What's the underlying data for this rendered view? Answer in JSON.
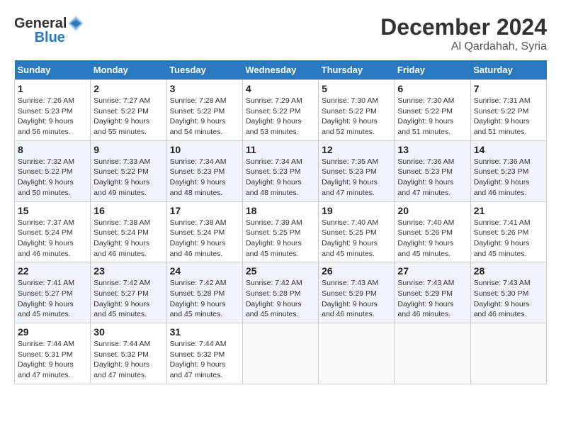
{
  "header": {
    "logo": {
      "text_general": "General",
      "text_blue": "Blue",
      "icon": "▶"
    },
    "title": "December 2024",
    "subtitle": "Al Qardahah, Syria"
  },
  "calendar": {
    "days_of_week": [
      "Sunday",
      "Monday",
      "Tuesday",
      "Wednesday",
      "Thursday",
      "Friday",
      "Saturday"
    ],
    "weeks": [
      [
        null,
        null,
        null,
        null,
        null,
        null,
        null
      ]
    ],
    "cells": [
      {
        "date": 1,
        "dow": 0,
        "sunrise": "7:26 AM",
        "sunset": "5:23 PM",
        "daylight": "9 hours and 56 minutes."
      },
      {
        "date": 2,
        "dow": 1,
        "sunrise": "7:27 AM",
        "sunset": "5:22 PM",
        "daylight": "9 hours and 55 minutes."
      },
      {
        "date": 3,
        "dow": 2,
        "sunrise": "7:28 AM",
        "sunset": "5:22 PM",
        "daylight": "9 hours and 54 minutes."
      },
      {
        "date": 4,
        "dow": 3,
        "sunrise": "7:29 AM",
        "sunset": "5:22 PM",
        "daylight": "9 hours and 53 minutes."
      },
      {
        "date": 5,
        "dow": 4,
        "sunrise": "7:30 AM",
        "sunset": "5:22 PM",
        "daylight": "9 hours and 52 minutes."
      },
      {
        "date": 6,
        "dow": 5,
        "sunrise": "7:30 AM",
        "sunset": "5:22 PM",
        "daylight": "9 hours and 51 minutes."
      },
      {
        "date": 7,
        "dow": 6,
        "sunrise": "7:31 AM",
        "sunset": "5:22 PM",
        "daylight": "9 hours and 51 minutes."
      },
      {
        "date": 8,
        "dow": 0,
        "sunrise": "7:32 AM",
        "sunset": "5:22 PM",
        "daylight": "9 hours and 50 minutes."
      },
      {
        "date": 9,
        "dow": 1,
        "sunrise": "7:33 AM",
        "sunset": "5:22 PM",
        "daylight": "9 hours and 49 minutes."
      },
      {
        "date": 10,
        "dow": 2,
        "sunrise": "7:34 AM",
        "sunset": "5:23 PM",
        "daylight": "9 hours and 48 minutes."
      },
      {
        "date": 11,
        "dow": 3,
        "sunrise": "7:34 AM",
        "sunset": "5:23 PM",
        "daylight": "9 hours and 48 minutes."
      },
      {
        "date": 12,
        "dow": 4,
        "sunrise": "7:35 AM",
        "sunset": "5:23 PM",
        "daylight": "9 hours and 47 minutes."
      },
      {
        "date": 13,
        "dow": 5,
        "sunrise": "7:36 AM",
        "sunset": "5:23 PM",
        "daylight": "9 hours and 47 minutes."
      },
      {
        "date": 14,
        "dow": 6,
        "sunrise": "7:36 AM",
        "sunset": "5:23 PM",
        "daylight": "9 hours and 46 minutes."
      },
      {
        "date": 15,
        "dow": 0,
        "sunrise": "7:37 AM",
        "sunset": "5:24 PM",
        "daylight": "9 hours and 46 minutes."
      },
      {
        "date": 16,
        "dow": 1,
        "sunrise": "7:38 AM",
        "sunset": "5:24 PM",
        "daylight": "9 hours and 46 minutes."
      },
      {
        "date": 17,
        "dow": 2,
        "sunrise": "7:38 AM",
        "sunset": "5:24 PM",
        "daylight": "9 hours and 46 minutes."
      },
      {
        "date": 18,
        "dow": 3,
        "sunrise": "7:39 AM",
        "sunset": "5:25 PM",
        "daylight": "9 hours and 45 minutes."
      },
      {
        "date": 19,
        "dow": 4,
        "sunrise": "7:40 AM",
        "sunset": "5:25 PM",
        "daylight": "9 hours and 45 minutes."
      },
      {
        "date": 20,
        "dow": 5,
        "sunrise": "7:40 AM",
        "sunset": "5:26 PM",
        "daylight": "9 hours and 45 minutes."
      },
      {
        "date": 21,
        "dow": 6,
        "sunrise": "7:41 AM",
        "sunset": "5:26 PM",
        "daylight": "9 hours and 45 minutes."
      },
      {
        "date": 22,
        "dow": 0,
        "sunrise": "7:41 AM",
        "sunset": "5:27 PM",
        "daylight": "9 hours and 45 minutes."
      },
      {
        "date": 23,
        "dow": 1,
        "sunrise": "7:42 AM",
        "sunset": "5:27 PM",
        "daylight": "9 hours and 45 minutes."
      },
      {
        "date": 24,
        "dow": 2,
        "sunrise": "7:42 AM",
        "sunset": "5:28 PM",
        "daylight": "9 hours and 45 minutes."
      },
      {
        "date": 25,
        "dow": 3,
        "sunrise": "7:42 AM",
        "sunset": "5:28 PM",
        "daylight": "9 hours and 45 minutes."
      },
      {
        "date": 26,
        "dow": 4,
        "sunrise": "7:43 AM",
        "sunset": "5:29 PM",
        "daylight": "9 hours and 46 minutes."
      },
      {
        "date": 27,
        "dow": 5,
        "sunrise": "7:43 AM",
        "sunset": "5:29 PM",
        "daylight": "9 hours and 46 minutes."
      },
      {
        "date": 28,
        "dow": 6,
        "sunrise": "7:43 AM",
        "sunset": "5:30 PM",
        "daylight": "9 hours and 46 minutes."
      },
      {
        "date": 29,
        "dow": 0,
        "sunrise": "7:44 AM",
        "sunset": "5:31 PM",
        "daylight": "9 hours and 47 minutes."
      },
      {
        "date": 30,
        "dow": 1,
        "sunrise": "7:44 AM",
        "sunset": "5:32 PM",
        "daylight": "9 hours and 47 minutes."
      },
      {
        "date": 31,
        "dow": 2,
        "sunrise": "7:44 AM",
        "sunset": "5:32 PM",
        "daylight": "9 hours and 47 minutes."
      }
    ],
    "labels": {
      "sunrise": "Sunrise:",
      "sunset": "Sunset:",
      "daylight": "Daylight:"
    }
  }
}
